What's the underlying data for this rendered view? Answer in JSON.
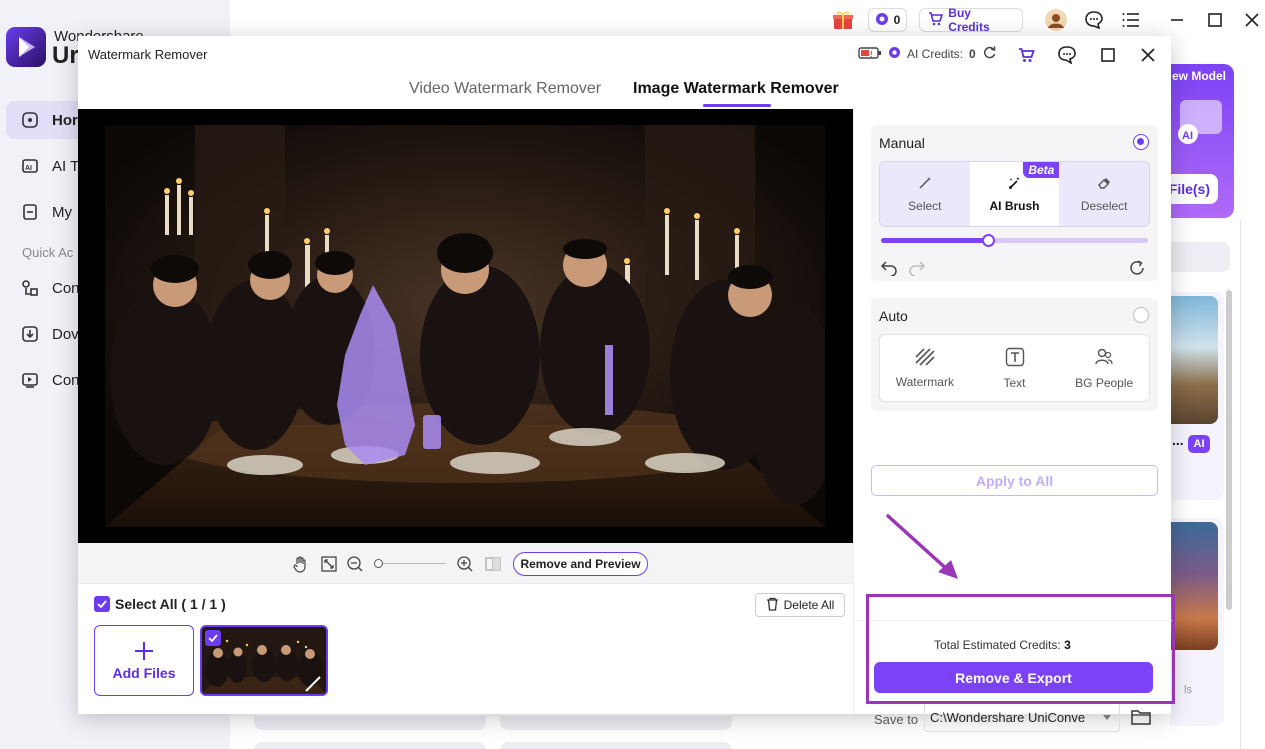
{
  "app": {
    "brand_top": "Wondershare",
    "brand_big": "Ur",
    "nav": [
      {
        "label": "Hor",
        "icon": "home-icon",
        "active": true
      },
      {
        "label": "AI To",
        "icon": "ai-tools-icon",
        "active": false
      },
      {
        "label": "My",
        "icon": "my-files-icon",
        "active": false
      },
      {
        "label": "Con",
        "icon": "converter-icon",
        "active": false
      },
      {
        "label": "Dov",
        "icon": "downloader-icon",
        "active": false
      },
      {
        "label": "Con",
        "icon": "compressor-icon",
        "active": false
      }
    ],
    "quick_access": "Quick Ac",
    "topbar": {
      "credits": "0",
      "buy_credits": "Buy Credits"
    },
    "promo_text": "ew Model",
    "promo_button": "File(s)",
    "ai_badge": "AI",
    "card_dots": "...",
    "card_tail": "ls"
  },
  "modal": {
    "title": "Watermark Remover",
    "ai_credits_label": "AI Credits:",
    "ai_credits_value": "0",
    "tabs": [
      {
        "label": "Video Watermark Remover",
        "active": false
      },
      {
        "label": "Image Watermark Remover",
        "active": true
      }
    ],
    "preview_button": "Remove and Preview",
    "select_all": "Select All ( 1 / 1 )",
    "delete_all": "Delete All",
    "add_files": "Add Files",
    "manual": {
      "title": "Manual",
      "tools": [
        {
          "label": "Select",
          "icon": "select-wand-icon"
        },
        {
          "label": "AI Brush",
          "icon": "ai-brush-icon",
          "badge": "Beta"
        },
        {
          "label": "Deselect",
          "icon": "eraser-icon"
        }
      ],
      "brush_size": 0.4
    },
    "auto": {
      "title": "Auto",
      "tools": [
        {
          "label": "Watermark",
          "icon": "watermark-icon"
        },
        {
          "label": "Text",
          "icon": "text-icon"
        },
        {
          "label": "BG People",
          "icon": "people-icon"
        }
      ]
    },
    "apply_all": "Apply to All",
    "estimated_label": "Total Estimated Credits:",
    "estimated_value": "3",
    "export_button": "Remove & Export",
    "save_to_label": "Save to",
    "save_path": "C:\\Wondershare UniConve"
  },
  "colors": {
    "accent": "#7c43f6",
    "highlight": "#9a35b8"
  }
}
